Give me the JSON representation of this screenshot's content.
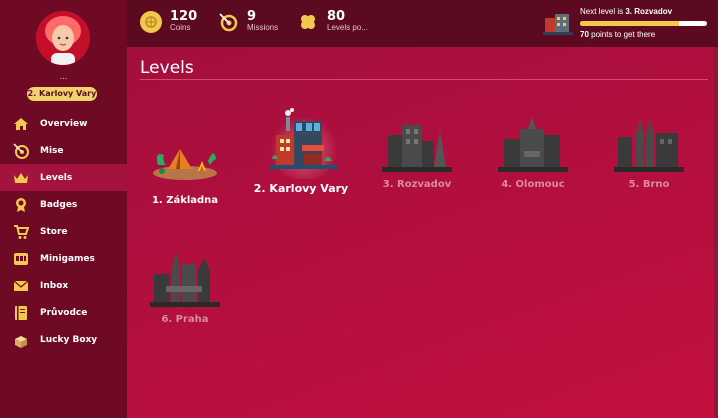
{
  "user": {
    "name": "...",
    "location": "2. Karlovy Vary"
  },
  "stats": {
    "coins": {
      "value": "120",
      "label": "Coins"
    },
    "missions": {
      "value": "9",
      "label": "Missions"
    },
    "levels": {
      "value": "80",
      "label": "Levels po..."
    }
  },
  "next_level": {
    "prefix": "Next level is ",
    "name": "3. Rozvadov",
    "points": "70",
    "points_suffix": " points to get there",
    "progress": 0.78
  },
  "sidebar": {
    "items": [
      {
        "label": "Overview",
        "icon": "home-icon"
      },
      {
        "label": "Mise",
        "icon": "missions-icon"
      },
      {
        "label": "Levels",
        "icon": "crown-icon"
      },
      {
        "label": "Badges",
        "icon": "badge-icon"
      },
      {
        "label": "Store",
        "icon": "cart-icon"
      },
      {
        "label": "Minigames",
        "icon": "slot-machine-icon"
      },
      {
        "label": "Inbox",
        "icon": "envelope-icon"
      },
      {
        "label": "Průvodce",
        "icon": "book-icon"
      },
      {
        "label": "Lucky Boxy",
        "icon": "gift-box-icon"
      }
    ],
    "active": "Levels"
  },
  "main": {
    "title": "Levels",
    "levels": [
      {
        "name": "1. Základna",
        "state": "unlocked"
      },
      {
        "name": "2. Karlovy Vary",
        "state": "current"
      },
      {
        "name": "3. Rozvadov",
        "state": "locked"
      },
      {
        "name": "4. Olomouc",
        "state": "locked"
      },
      {
        "name": "5. Brno",
        "state": "locked"
      },
      {
        "name": "6. Praha",
        "state": "locked"
      }
    ]
  },
  "colors": {
    "accent_gold": "#f2c94c",
    "sidebar_bg": "#6e0a24",
    "main_bg": "#b60f3f"
  }
}
